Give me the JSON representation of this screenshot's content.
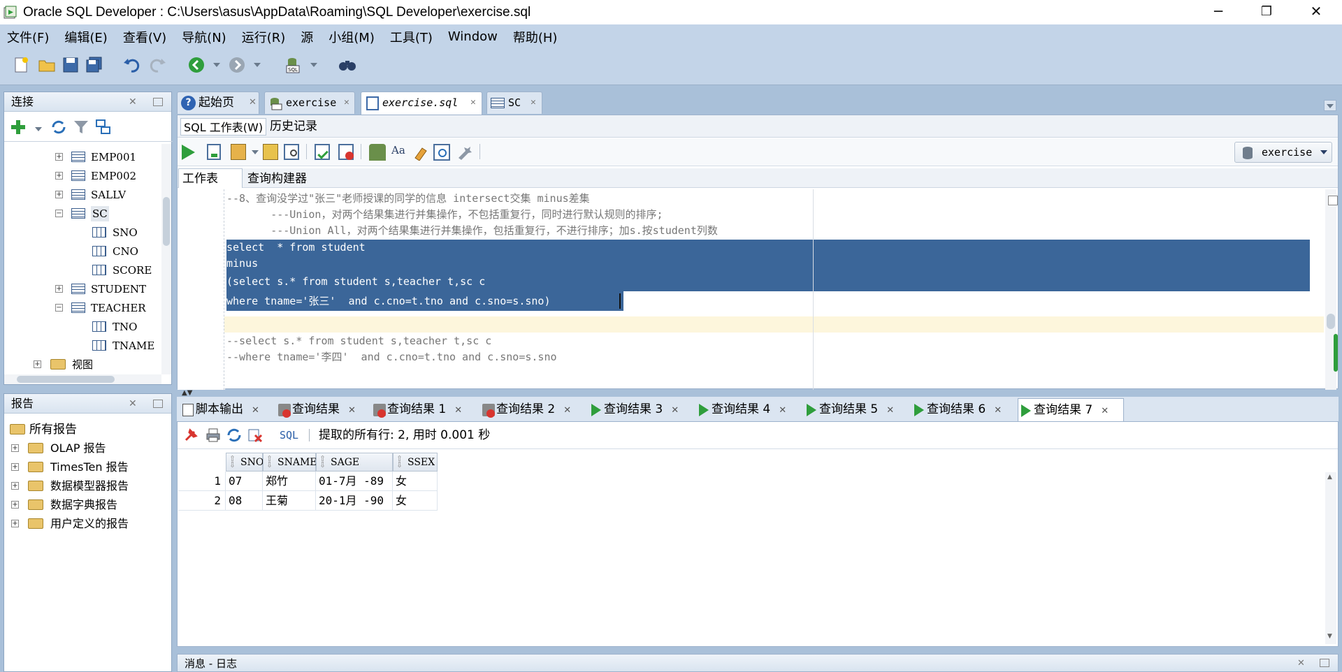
{
  "window": {
    "title": "Oracle SQL Developer : C:\\Users\\asus\\AppData\\Roaming\\SQL Developer\\exercise.sql",
    "minimize": "─",
    "restore": "❐",
    "close": "✕"
  },
  "menu": [
    "文件(F)",
    "编辑(E)",
    "查看(V)",
    "导航(N)",
    "运行(R)",
    "源",
    "小组(M)",
    "工具(T)",
    "Window",
    "帮助(H)"
  ],
  "connections": {
    "title": "连接",
    "tree": [
      {
        "label": "EMP001",
        "type": "table",
        "expanded": false
      },
      {
        "label": "EMP002",
        "type": "table",
        "expanded": false
      },
      {
        "label": "SALLV",
        "type": "table",
        "expanded": false
      },
      {
        "label": "SC",
        "type": "table",
        "expanded": true
      },
      {
        "label": "SNO",
        "type": "column"
      },
      {
        "label": "CNO",
        "type": "column"
      },
      {
        "label": "SCORE",
        "type": "column"
      },
      {
        "label": "STUDENT",
        "type": "table",
        "expanded": false
      },
      {
        "label": "TEACHER",
        "type": "table",
        "expanded": true
      },
      {
        "label": "TNO",
        "type": "column"
      },
      {
        "label": "TNAME",
        "type": "column"
      },
      {
        "label": "视图",
        "type": "folder"
      }
    ]
  },
  "reports": {
    "title": "报告",
    "root": "所有报告",
    "items": [
      "OLAP 报告",
      "TimesTen 报告",
      "数据模型器报告",
      "数据字典报告",
      "用户定义的报告"
    ]
  },
  "editor_tabs": [
    {
      "label": "起始页",
      "active": false
    },
    {
      "label": "exercise",
      "active": false
    },
    {
      "label": "exercise.sql",
      "active": true
    },
    {
      "label": "SC",
      "active": false
    }
  ],
  "subtabs": {
    "worksheet": "SQL 工作表(W)",
    "history": "历史记录"
  },
  "connection_select": "exercise",
  "worksheet_tabs": {
    "worksheet": "工作表",
    "builder": "查询构建器"
  },
  "code_lines": [
    {
      "text": "--8、查询没学过\"张三\"老师授课的同学的信息 intersect交集 minus差集",
      "kind": "comment"
    },
    {
      "text": "       ---Union，对两个结果集进行并集操作，不包括重复行，同时进行默认规则的排序;",
      "kind": "comment"
    },
    {
      "text": "       ---Union All，对两个结果集进行并集操作，包括重复行，不进行排序；加s.按student列数",
      "kind": "comment"
    },
    {
      "text": "select  * from student",
      "kind": "selected"
    },
    {
      "text": "minus",
      "kind": "selected"
    },
    {
      "text": "(select s.* from student s,teacher t,sc c",
      "kind": "selected"
    },
    {
      "text": "where tname='张三'  and c.cno=t.tno and c.sno=s.sno)",
      "kind": "selected-last"
    },
    {
      "text": "",
      "kind": "blank"
    },
    {
      "text": "--select s.* from student s,teacher t,sc c",
      "kind": "comment"
    },
    {
      "text": "--where tname='李四'  and c.cno=t.tno and c.sno=s.sno",
      "kind": "comment"
    }
  ],
  "result_tabs": [
    {
      "label": "脚本输出",
      "icon": "script",
      "active": false
    },
    {
      "label": "查询结果",
      "icon": "error",
      "active": false
    },
    {
      "label": "查询结果 1",
      "icon": "error",
      "active": false
    },
    {
      "label": "查询结果 2",
      "icon": "error",
      "active": false
    },
    {
      "label": "查询结果 3",
      "icon": "play",
      "active": false
    },
    {
      "label": "查询结果 4",
      "icon": "play",
      "active": false
    },
    {
      "label": "查询结果 5",
      "icon": "play",
      "active": false
    },
    {
      "label": "查询结果 6",
      "icon": "play",
      "active": false
    },
    {
      "label": "查询结果 7",
      "icon": "play",
      "active": true
    }
  ],
  "result_toolbar": {
    "sql_link": "SQL",
    "status": "提取的所有行: 2, 用时 0.001 秒"
  },
  "grid": {
    "columns": [
      "SNO",
      "SNAME",
      "SAGE",
      "SSEX"
    ],
    "rows": [
      {
        "num": "1",
        "cells": [
          "07",
          "郑竹",
          "01-7月 -89",
          "女"
        ]
      },
      {
        "num": "2",
        "cells": [
          "08",
          "王菊",
          "20-1月 -90",
          "女"
        ]
      }
    ]
  },
  "log": {
    "title": "消息 - 日志"
  }
}
